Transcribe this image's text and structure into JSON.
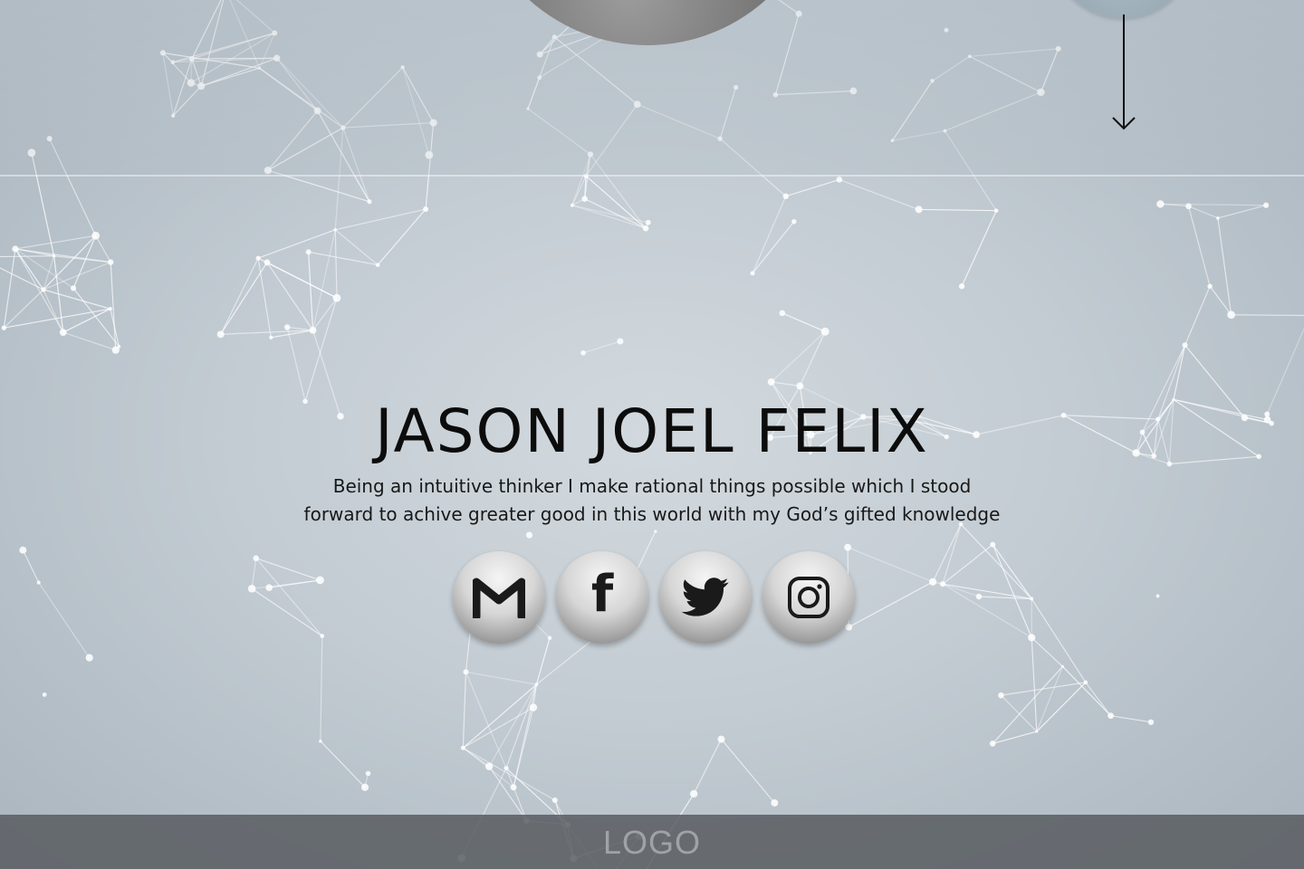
{
  "hero": {
    "name": "JASON JOEL FELIX",
    "tagline_line1": "Being an intuitive thinker I make rational things possible which I stood",
    "tagline_line2": "forward to achive greater good in this world with my God’s gifted knowledge"
  },
  "socials": [
    {
      "name": "Gmail",
      "icon": "gmail-icon"
    },
    {
      "name": "Facebook",
      "icon": "facebook-icon",
      "glyph": "f"
    },
    {
      "name": "Twitter",
      "icon": "twitter-icon"
    },
    {
      "name": "Instagram",
      "icon": "instagram-icon"
    }
  ],
  "footer": {
    "logo": "LOGO"
  },
  "icons": {
    "scroll": "arrow-down-icon"
  },
  "colors": {
    "background": "#bcc6ce",
    "text": "#0c0c0c",
    "footer": "#585c60",
    "footer_text": "#9ea3a8",
    "network_lines": "#ffffff"
  }
}
